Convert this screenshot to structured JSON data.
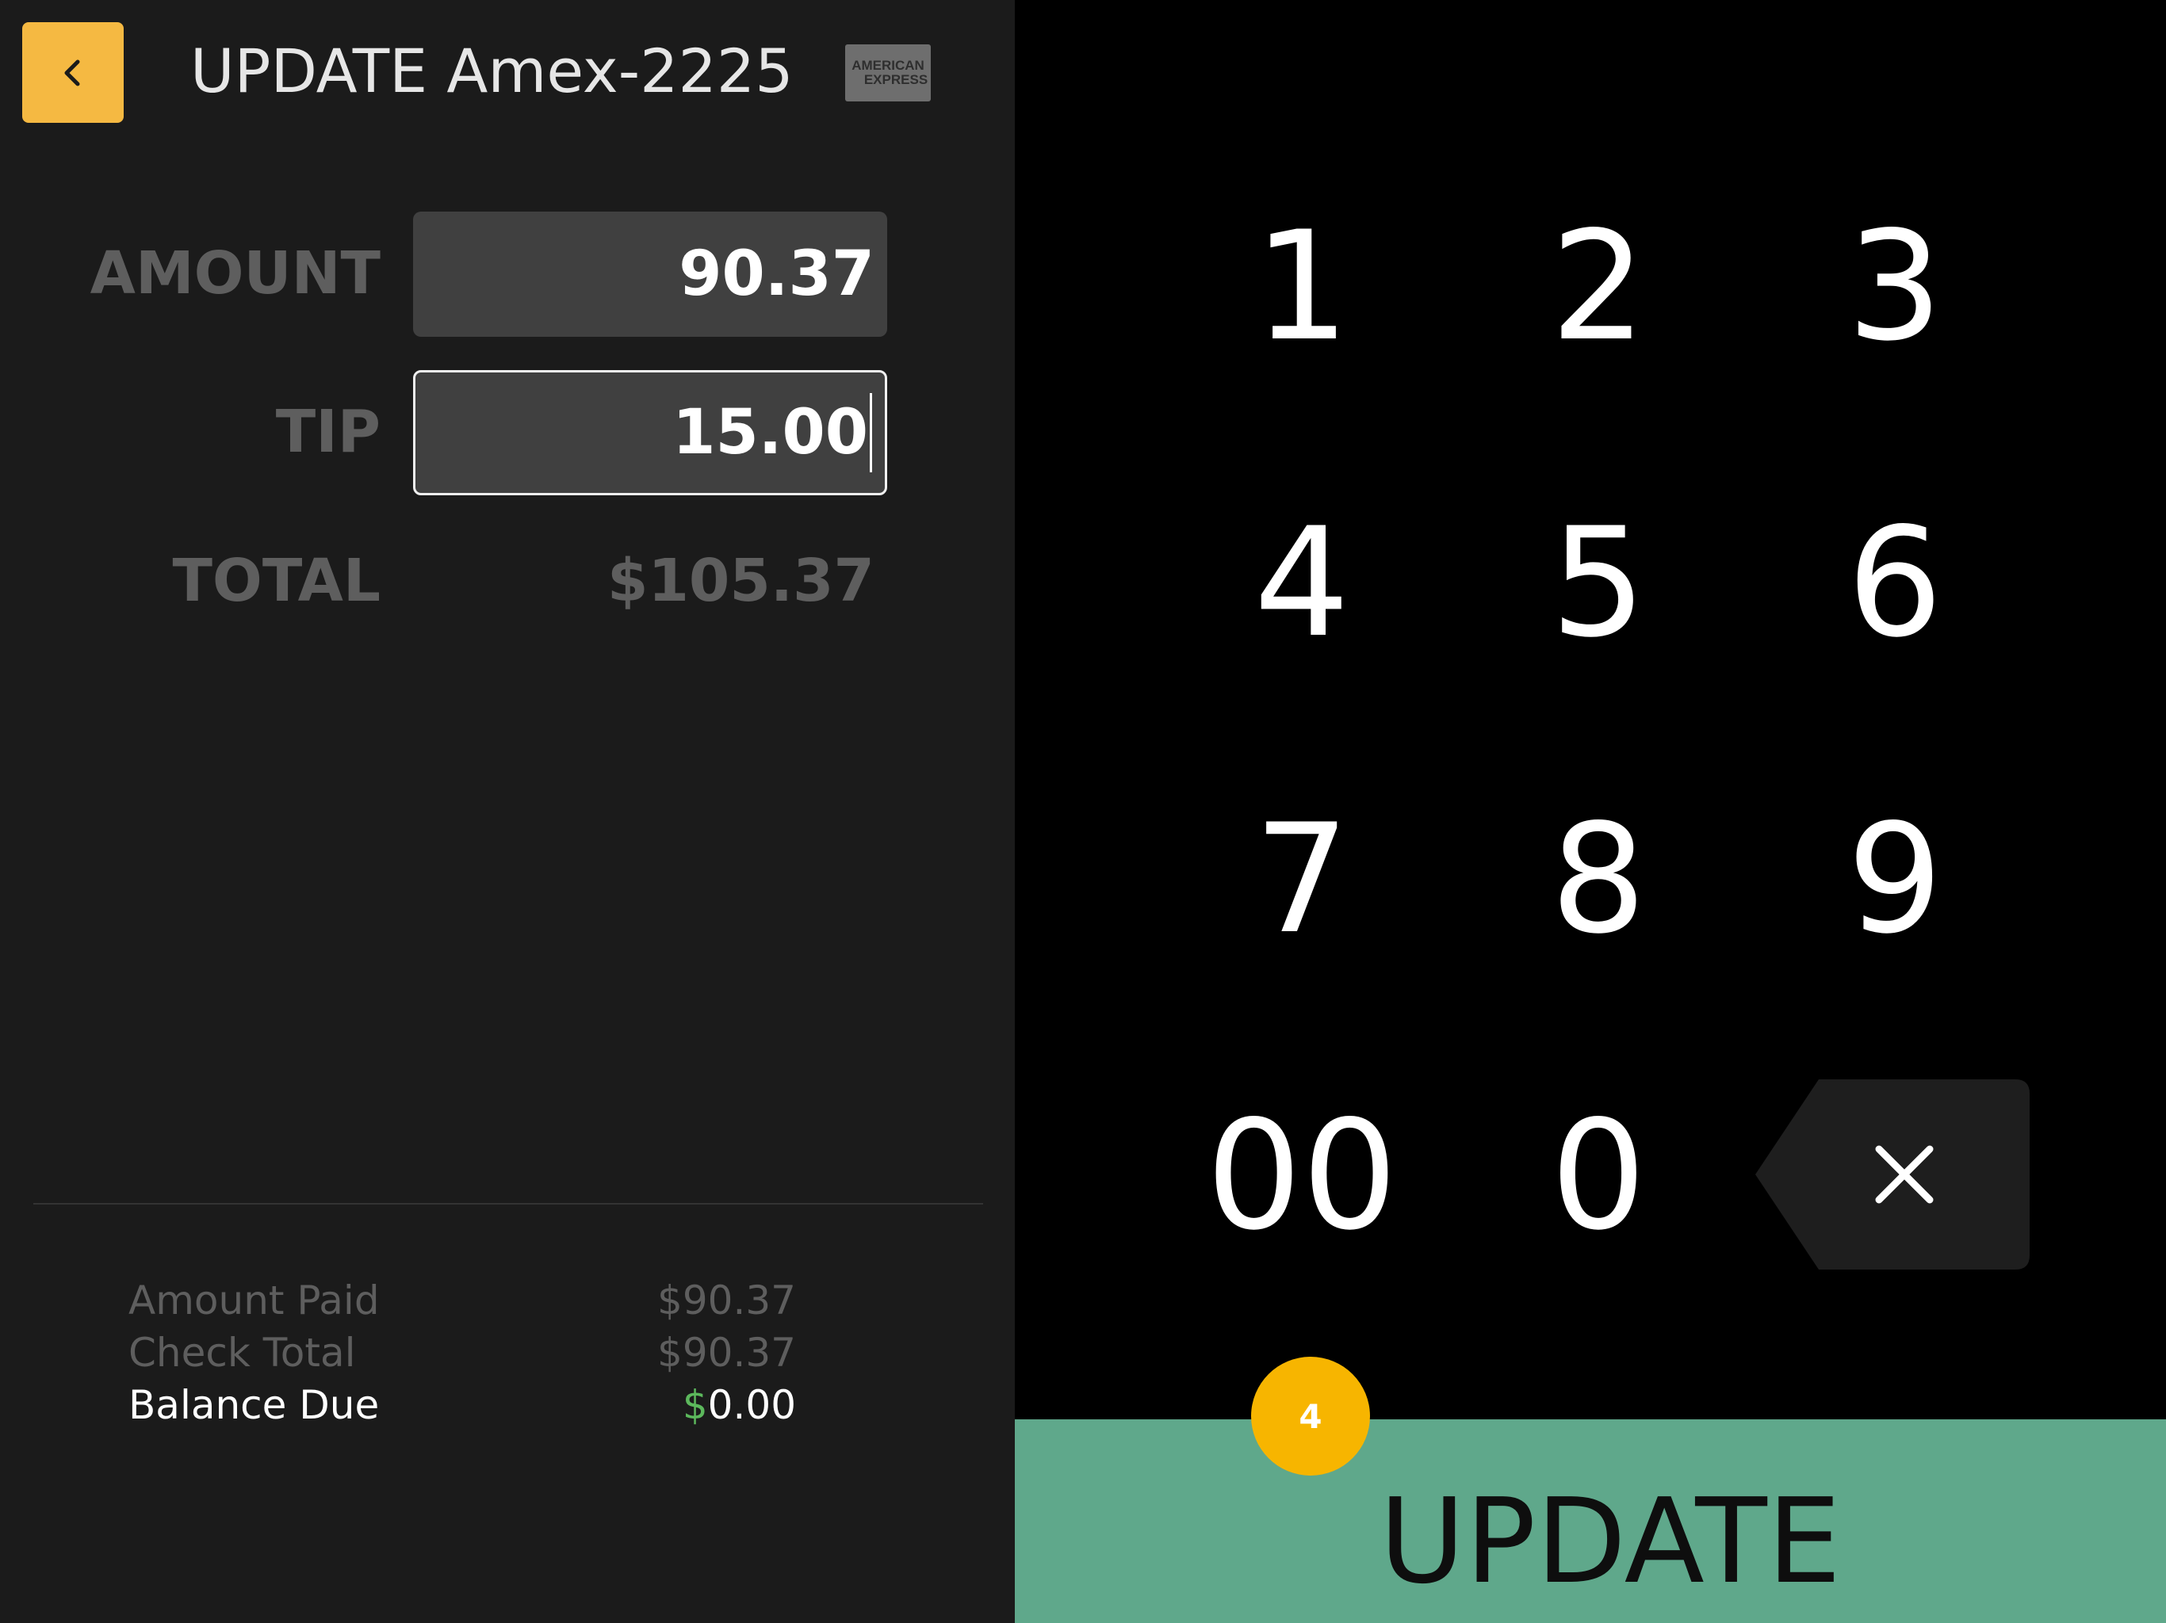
{
  "header": {
    "title": "UPDATE Amex-2225",
    "back_icon": "chevron-left-icon",
    "card_logo_lines": [
      "AMERICAN",
      "EXPRESS"
    ]
  },
  "form": {
    "amount_label": "AMOUNT",
    "amount_value": "90.37",
    "tip_label": "TIP",
    "tip_value": "15.00",
    "total_label": "TOTAL",
    "total_value": "$105.37"
  },
  "summary": {
    "amount_paid_label": "Amount Paid",
    "amount_paid_value": "$90.37",
    "check_total_label": "Check Total",
    "check_total_value": "$90.37",
    "balance_due_label": "Balance Due",
    "balance_due_currency": "$",
    "balance_due_amount": "0.00"
  },
  "keypad": {
    "keys": [
      "1",
      "2",
      "3",
      "4",
      "5",
      "6",
      "7",
      "8",
      "9",
      "00",
      "0"
    ],
    "backspace_icon": "backspace-icon"
  },
  "action": {
    "update_label": "UPDATE",
    "badge": "4"
  },
  "colors": {
    "accent": "#f5b942",
    "update_bar": "#5fa88b",
    "badge": "#f7b500",
    "balance_currency": "#5cb85c"
  }
}
